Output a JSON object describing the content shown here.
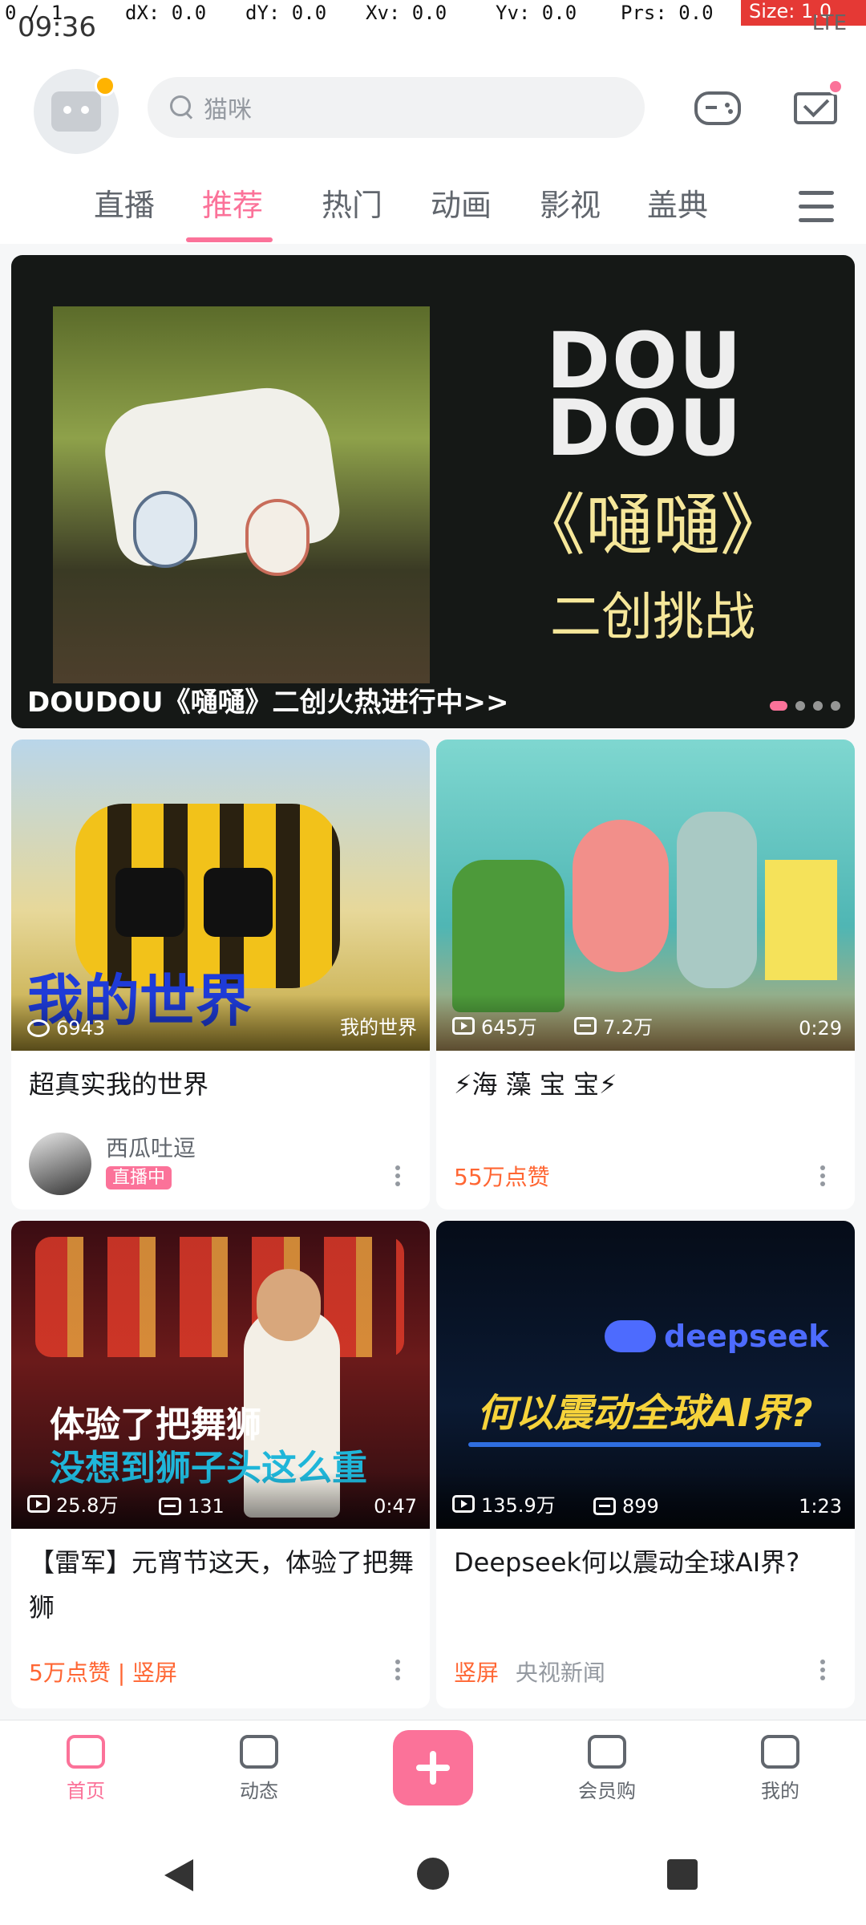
{
  "statusbar": {
    "time": "09:36",
    "debug": {
      "pointer": "0 / 1",
      "dx": "dX: 0.0",
      "dy": "dY: 0.0",
      "xv": "Xv: 0.0",
      "yv": "Yv: 0.0",
      "prs": "Prs: 0.0",
      "size": "Size: 1.0"
    },
    "network": "LTE"
  },
  "header": {
    "search_placeholder": "猫咪"
  },
  "tabs": [
    {
      "label": "直播"
    },
    {
      "label": "推荐",
      "active": true
    },
    {
      "label": "热门"
    },
    {
      "label": "动画"
    },
    {
      "label": "影视"
    },
    {
      "label": "盖典"
    }
  ],
  "banner": {
    "logo": "DOU DOU",
    "cn_title": "《嗵嗵》",
    "cn_sub": "二创挑战",
    "caption": "DOUDOU《嗵嗵》二创火热进行中>>"
  },
  "cards": [
    {
      "thumb_text": "我的世界",
      "stat1": "6943",
      "stat_right": "我的世界",
      "title": "超真实我的世界",
      "up_name": "西瓜吐逗",
      "live_label": "直播中"
    },
    {
      "stat1": "645万",
      "stat2": "7.2万",
      "stat_right": "0:29",
      "title": "⚡海 藻 宝 宝⚡",
      "likes": "55万点赞"
    },
    {
      "thumb_line1": "体验了把舞狮",
      "thumb_line2": "没想到狮子头这么重",
      "stat1": "25.8万",
      "stat2": "131",
      "stat_right": "0:47",
      "title": "【雷军】元宵节这天，体验了把舞狮",
      "likes": "5万点赞 | 竖屏"
    },
    {
      "thumb_brand": "deepseek",
      "thumb_line": "何以震动全球AI界?",
      "stat1": "135.9万",
      "stat2": "899",
      "stat_right": "1:23",
      "title": "Deepseek何以震动全球AI界?",
      "tag": "竖屏",
      "channel": "央视新闻"
    }
  ],
  "bottom_nav": [
    {
      "label": "首页",
      "active": true
    },
    {
      "label": "动态"
    },
    {
      "label": ""
    },
    {
      "label": "会员购"
    },
    {
      "label": "我的"
    }
  ],
  "colors": {
    "accent": "#fb7299",
    "text": "#18191c",
    "muted": "#9499a0"
  }
}
